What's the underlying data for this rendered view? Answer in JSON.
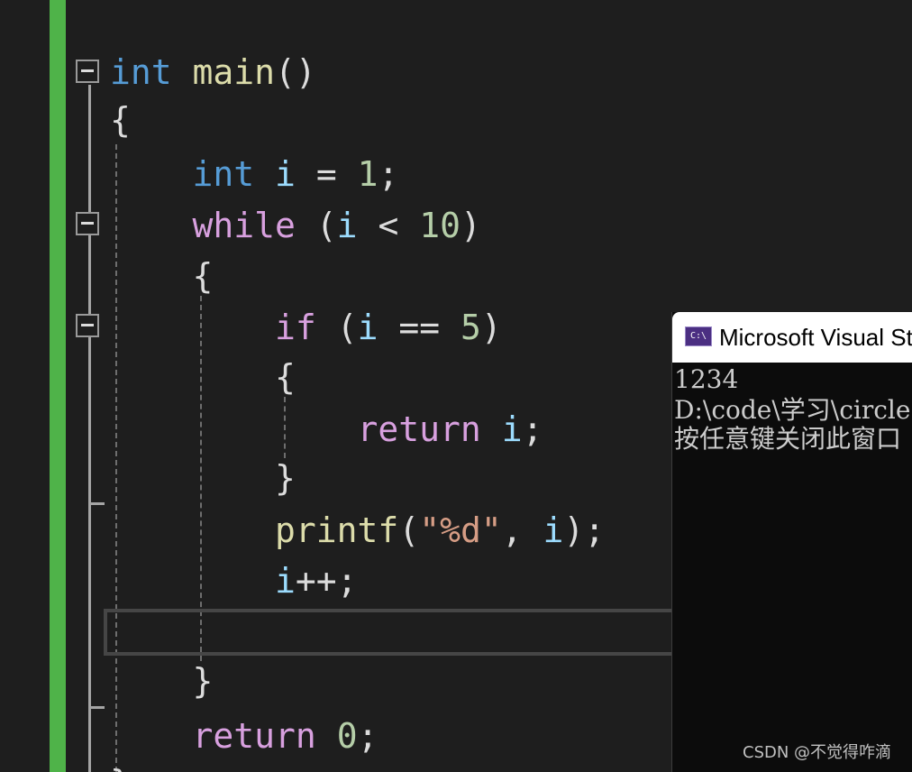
{
  "editor": {
    "lines": [
      {
        "tokens": [
          {
            "t": "int",
            "c": "kw"
          },
          {
            "t": " ",
            "c": "punc"
          },
          {
            "t": "main",
            "c": "fn"
          },
          {
            "t": "()",
            "c": "punc"
          }
        ]
      },
      {
        "tokens": [
          {
            "t": "{",
            "c": "punc"
          }
        ]
      },
      {
        "tokens": [
          {
            "t": "    ",
            "c": "punc"
          },
          {
            "t": "int",
            "c": "kw"
          },
          {
            "t": " ",
            "c": "punc"
          },
          {
            "t": "i",
            "c": "var"
          },
          {
            "t": " = ",
            "c": "punc"
          },
          {
            "t": "1",
            "c": "num"
          },
          {
            "t": ";",
            "c": "punc"
          }
        ]
      },
      {
        "tokens": [
          {
            "t": "    ",
            "c": "punc"
          },
          {
            "t": "while",
            "c": "ctl"
          },
          {
            "t": " (",
            "c": "punc"
          },
          {
            "t": "i",
            "c": "var"
          },
          {
            "t": " < ",
            "c": "punc"
          },
          {
            "t": "10",
            "c": "num"
          },
          {
            "t": ")",
            "c": "punc"
          }
        ]
      },
      {
        "tokens": [
          {
            "t": "    {",
            "c": "punc"
          }
        ]
      },
      {
        "tokens": [
          {
            "t": "        ",
            "c": "punc"
          },
          {
            "t": "if",
            "c": "ctl"
          },
          {
            "t": " (",
            "c": "punc"
          },
          {
            "t": "i",
            "c": "var"
          },
          {
            "t": " == ",
            "c": "punc"
          },
          {
            "t": "5",
            "c": "num"
          },
          {
            "t": ")",
            "c": "punc"
          }
        ]
      },
      {
        "tokens": [
          {
            "t": "        {",
            "c": "punc"
          }
        ]
      },
      {
        "tokens": [
          {
            "t": "            ",
            "c": "punc"
          },
          {
            "t": "return",
            "c": "ctl"
          },
          {
            "t": " ",
            "c": "punc"
          },
          {
            "t": "i",
            "c": "var"
          },
          {
            "t": ";",
            "c": "punc"
          }
        ]
      },
      {
        "tokens": [
          {
            "t": "        }",
            "c": "punc"
          }
        ]
      },
      {
        "tokens": [
          {
            "t": "        ",
            "c": "punc"
          },
          {
            "t": "printf",
            "c": "fn"
          },
          {
            "t": "(",
            "c": "punc"
          },
          {
            "t": "\"%d\"",
            "c": "str"
          },
          {
            "t": ", ",
            "c": "punc"
          },
          {
            "t": "i",
            "c": "var"
          },
          {
            "t": ");",
            "c": "punc"
          }
        ]
      },
      {
        "tokens": [
          {
            "t": "        ",
            "c": "punc"
          },
          {
            "t": "i",
            "c": "var"
          },
          {
            "t": "++;",
            "c": "punc"
          }
        ]
      },
      {
        "tokens": [
          {
            "t": "",
            "c": "punc"
          }
        ]
      },
      {
        "tokens": [
          {
            "t": "    }",
            "c": "punc"
          }
        ]
      },
      {
        "tokens": [
          {
            "t": "    ",
            "c": "punc"
          },
          {
            "t": "return",
            "c": "ctl"
          },
          {
            "t": " ",
            "c": "punc"
          },
          {
            "t": "0",
            "c": "num"
          },
          {
            "t": ";",
            "c": "punc"
          }
        ]
      },
      {
        "tokens": [
          {
            "t": "}",
            "c": "punc"
          }
        ]
      }
    ]
  },
  "console": {
    "icon_text": "C:\\",
    "title": "Microsoft Visual Studio",
    "output": [
      "1234",
      "D:\\code\\学习\\circle",
      "按任意键关闭此窗口"
    ]
  },
  "watermark": "CSDN @不觉得咋滴"
}
